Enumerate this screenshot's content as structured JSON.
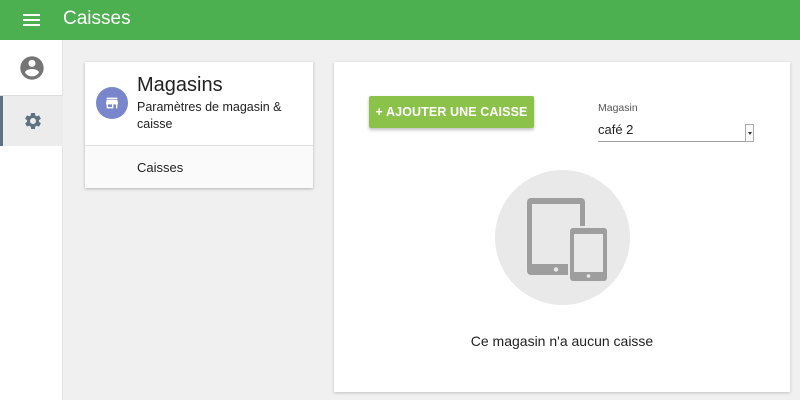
{
  "app": {
    "title": "Caisses"
  },
  "icons": {
    "menu": "menu-icon",
    "account": "account-circle-icon",
    "settings": "gear-icon",
    "store": "store-icon",
    "devices": "tablet-phone-icon"
  },
  "colors": {
    "topbar": "#4caf50",
    "add_button": "#8bc34a",
    "store_avatar": "#7986cb",
    "nav_active_border": "#5d7382"
  },
  "settings_card": {
    "title": "Magasins",
    "subtitle": "Paramètres de magasin & caisse",
    "items": [
      {
        "label": "Caisses"
      }
    ]
  },
  "main": {
    "add_button_label": "+ AJOUTER UNE CAISSE",
    "store_field": {
      "label": "Magasin",
      "value": "café 2"
    },
    "empty_message": "Ce magasin n'a aucun caisse"
  }
}
